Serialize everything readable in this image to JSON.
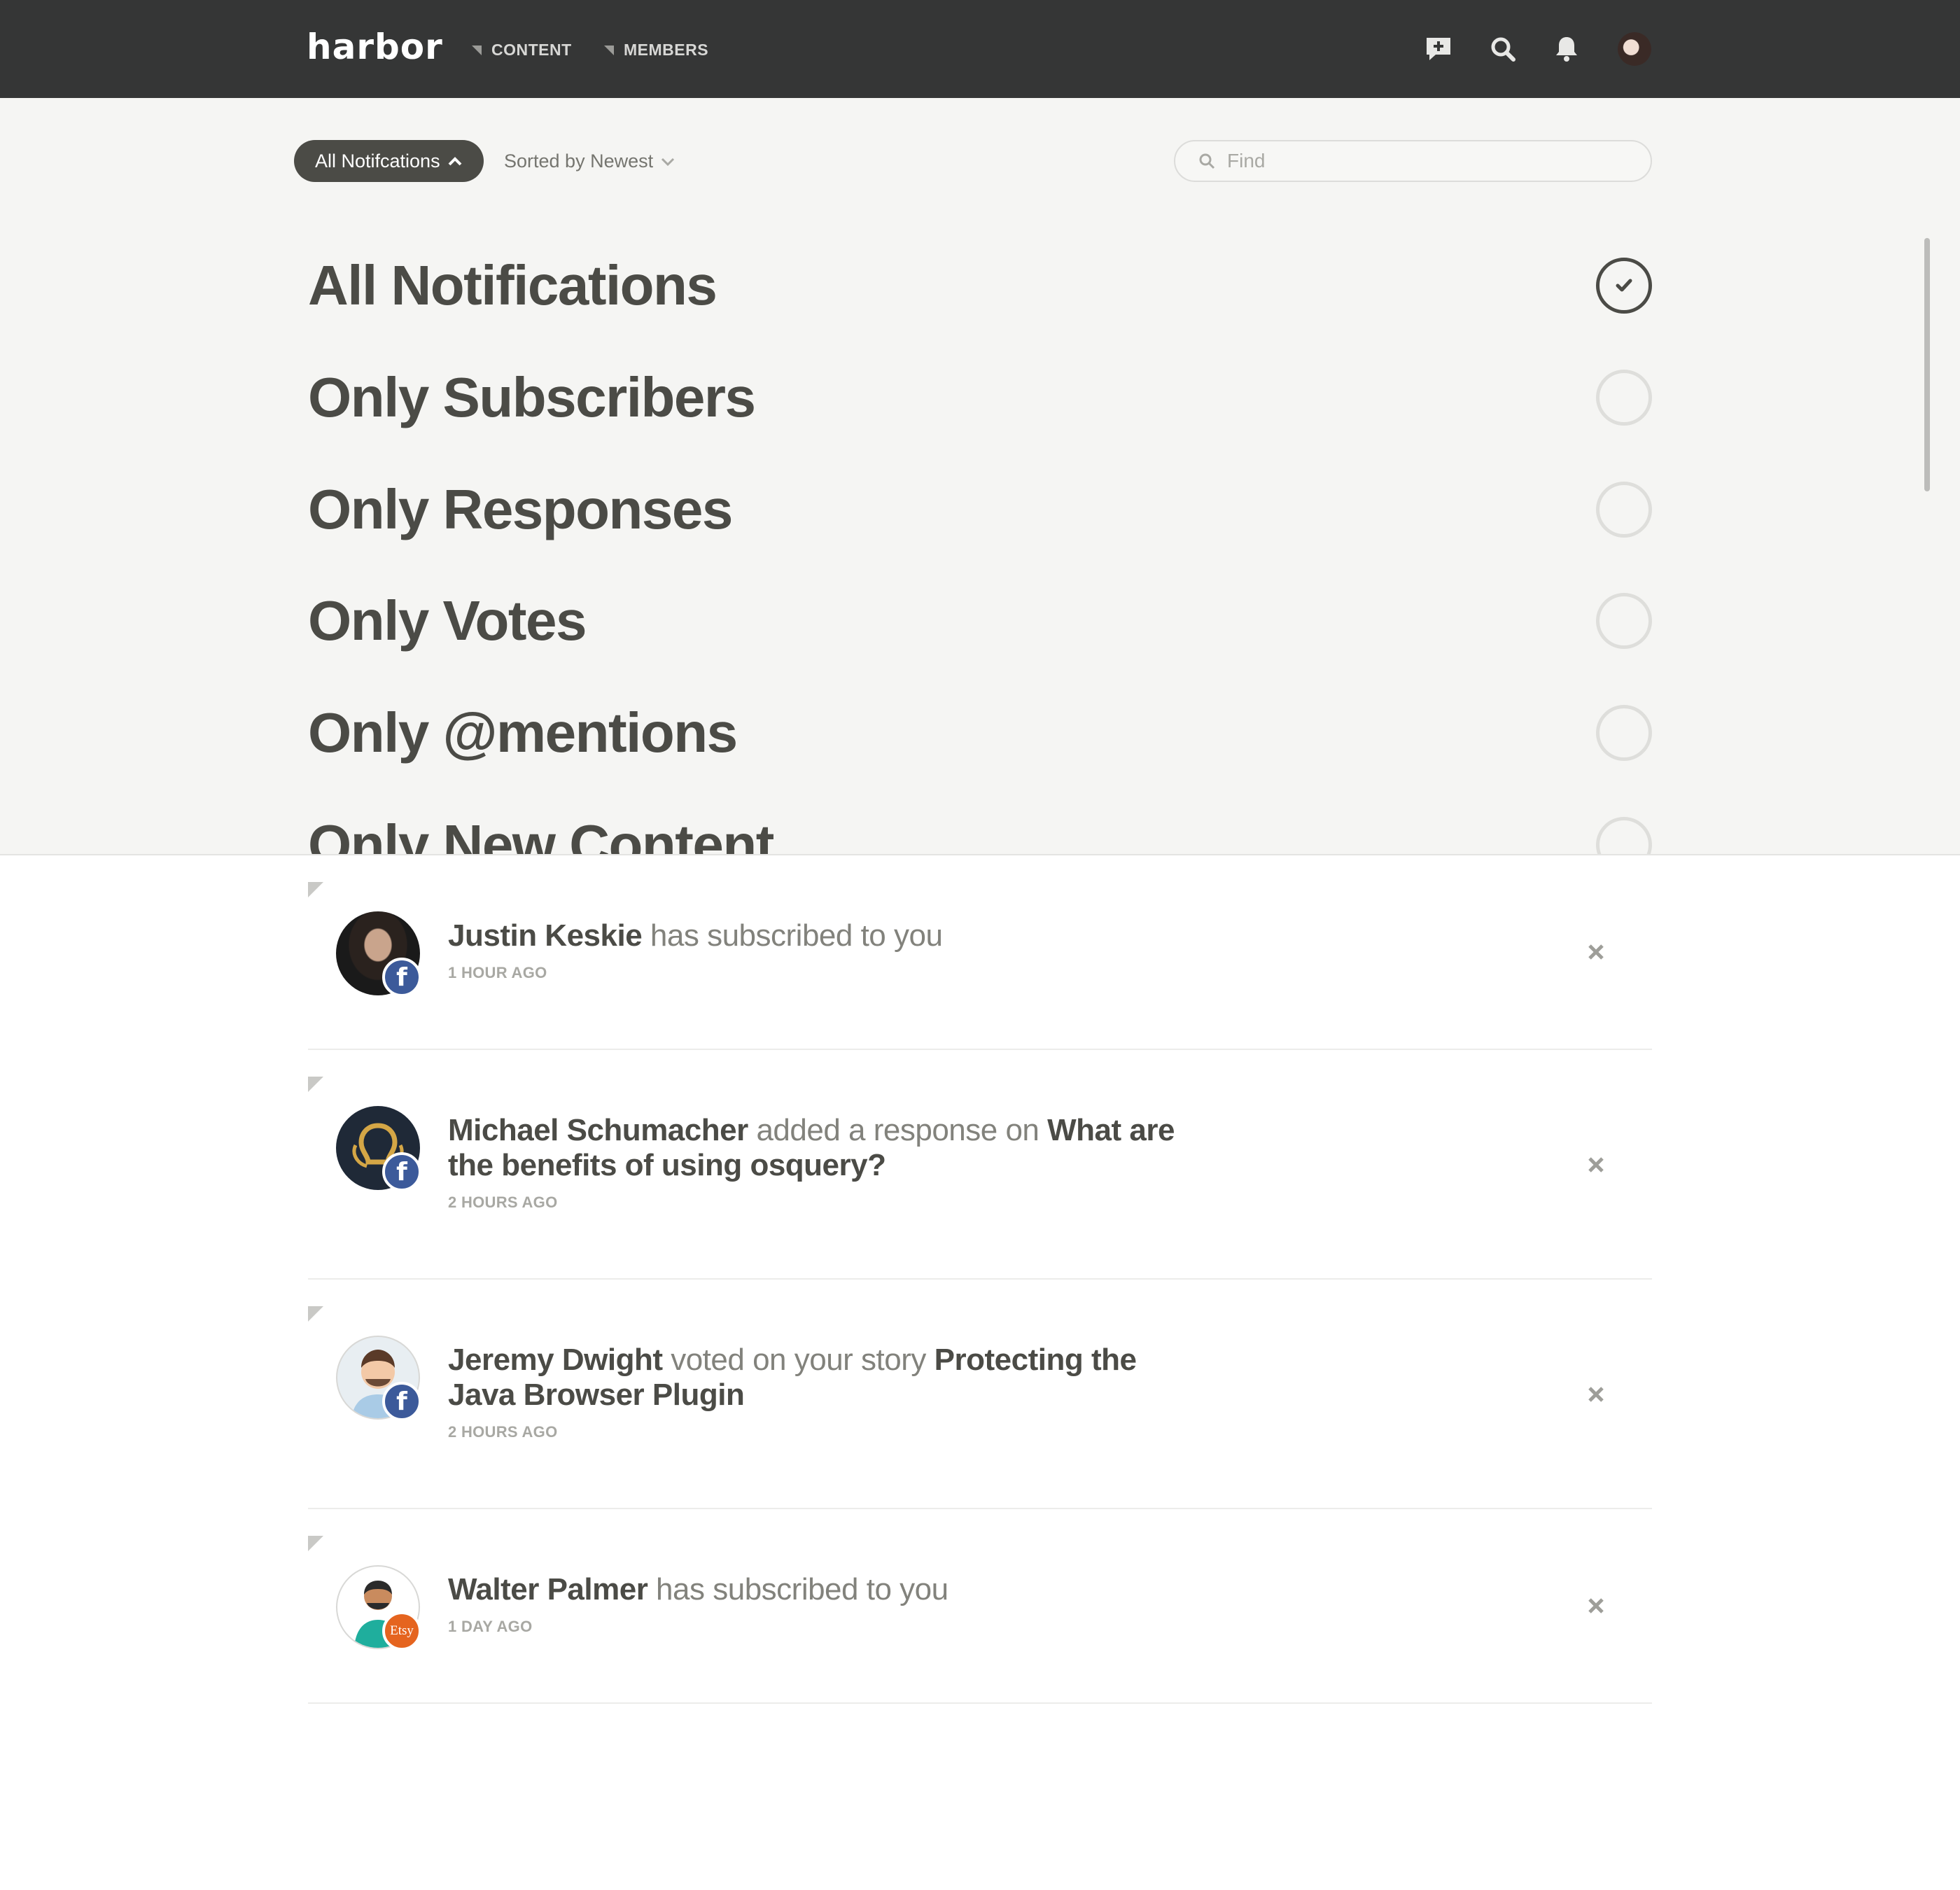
{
  "header": {
    "logo": "harbor",
    "nav": [
      {
        "label": "CONTENT"
      },
      {
        "label": "MEMBERS"
      }
    ],
    "icons": [
      "new-post-icon",
      "search-icon",
      "bell-icon",
      "user-avatar"
    ]
  },
  "toolbar": {
    "filter_pill": "All Notifcations",
    "sort_label": "Sorted by Newest",
    "find_placeholder": "Find"
  },
  "filters": [
    {
      "label": "All Notifications",
      "checked": true
    },
    {
      "label": "Only Subscribers",
      "checked": false
    },
    {
      "label": "Only Responses",
      "checked": false
    },
    {
      "label": "Only Votes",
      "checked": false
    },
    {
      "label": "Only @mentions",
      "checked": false
    },
    {
      "label": "Only New Content",
      "checked": false
    }
  ],
  "notifications": [
    {
      "name": "Justin Keskie",
      "action": " has subscribed to you",
      "target": "",
      "time": "1 HOUR AGO",
      "badge": "f",
      "badge_type": "facebook"
    },
    {
      "name": "Michael Schumacher",
      "action": " added a response on ",
      "target": "What are the benefits of using osquery?",
      "time": "2 HOURS AGO",
      "badge": "f",
      "badge_type": "facebook"
    },
    {
      "name": "Jeremy Dwight",
      "action": " voted on your story ",
      "target": "Protecting the Java Browser Plugin",
      "time": "2 HOURS AGO",
      "badge": "f",
      "badge_type": "facebook"
    },
    {
      "name": "Walter Palmer",
      "action": " has subscribed to you",
      "target": "",
      "time": "1 DAY AGO",
      "badge": "Etsy",
      "badge_type": "etsy"
    }
  ],
  "colors": {
    "topbar": "#353636",
    "panel": "#f5f5f3",
    "text_dark": "#4b4b46",
    "facebook": "#3c5a9a",
    "etsy": "#e5641f"
  }
}
